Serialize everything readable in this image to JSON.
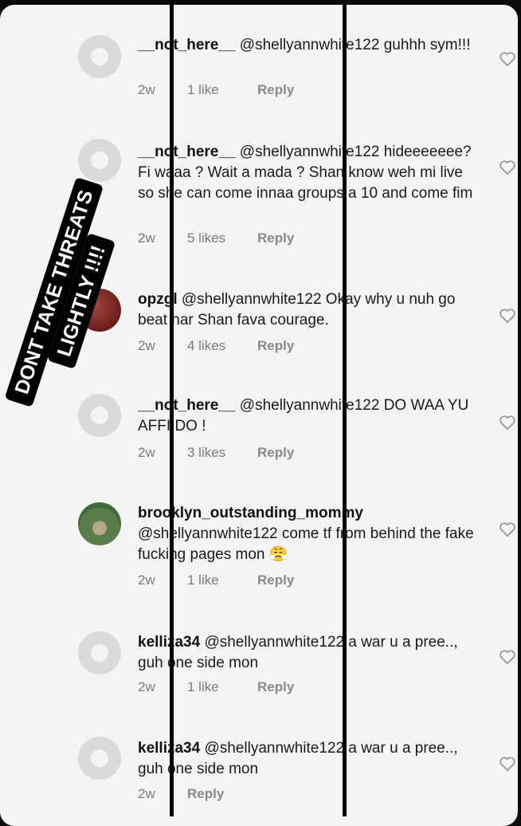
{
  "comments": [
    {
      "user": "__not_here__",
      "text": "@shellyannwhite122 guhhh sym!!!",
      "time": "2w",
      "likes": "1 like",
      "reply": "Reply",
      "avatar": "default"
    },
    {
      "user": "__not_here__",
      "text": "@shellyannwhite122 hideeeeeee? Fi waaa ? Wait a mada ? Shan know weh mi live so she can come innaa groups a 10 and come fim",
      "time": "2w",
      "likes": "5 likes",
      "reply": "Reply",
      "avatar": "default"
    },
    {
      "user": "opzgl",
      "text": "@shellyannwhite122 Okay why u nuh go beat har Shan fava courage.",
      "time": "2w",
      "likes": "4 likes",
      "reply": "Reply",
      "avatar": "dark"
    },
    {
      "user": "__not_here__",
      "text": "@shellyannwhite122 DO WAA YU AFFI DO !",
      "time": "2w",
      "likes": "3 likes",
      "reply": "Reply",
      "avatar": "default"
    },
    {
      "user": "brooklyn_outstanding_mommy",
      "text": "@shellyannwhite122 come tf from behind the fake fucking pages mon 😤",
      "time": "2w",
      "likes": "1 like",
      "reply": "Reply",
      "avatar": "photo"
    },
    {
      "user": "kelliza34",
      "text": "@shellyannwhite122 a war u a pree.., guh one side mon",
      "time": "2w",
      "likes": "1 like",
      "reply": "Reply",
      "avatar": "default"
    },
    {
      "user": "kelliza34",
      "text": "@shellyannwhite122 a war u a pree.., guh one side mon",
      "time": "2w",
      "likes": "",
      "reply": "Reply",
      "avatar": "default"
    }
  ],
  "banner": {
    "line1": "DONT TAKE THREATS",
    "line2": "LIGHTLY !!!!"
  },
  "icons": {
    "like": "heart-outline-icon",
    "avatar": "default-avatar-icon"
  }
}
